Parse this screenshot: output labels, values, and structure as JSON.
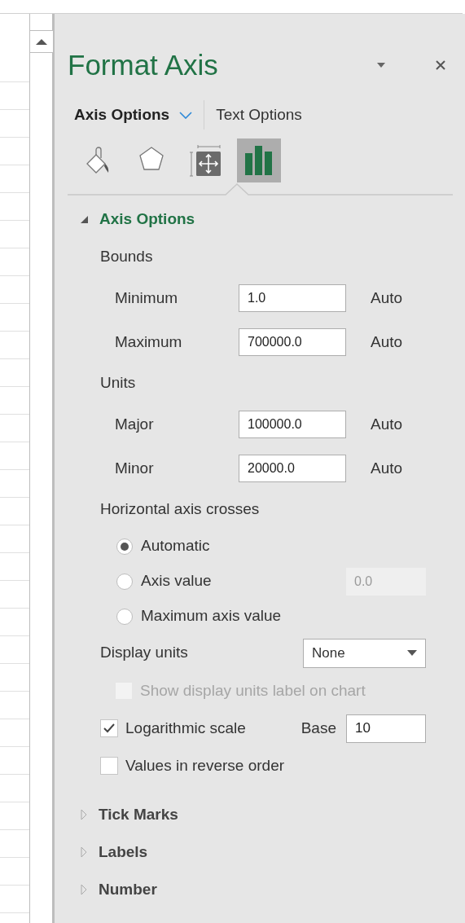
{
  "pane": {
    "title": "Format Axis",
    "tabs": [
      {
        "label": "Axis Options",
        "selected": true
      },
      {
        "label": "Text Options",
        "selected": false
      }
    ],
    "icon_tabs": [
      {
        "kind": "fill",
        "selected": false
      },
      {
        "kind": "effects",
        "selected": false
      },
      {
        "kind": "size",
        "selected": false
      },
      {
        "kind": "axis",
        "selected": true
      }
    ],
    "sections": [
      {
        "title": "Axis Options",
        "expanded": true,
        "rows": [
          {
            "kind": "heading",
            "label": "Bounds"
          },
          {
            "kind": "number",
            "label": "Minimum",
            "value": "1.0",
            "action": "Auto"
          },
          {
            "kind": "number",
            "label": "Maximum",
            "value": "700000.0",
            "action": "Auto"
          },
          {
            "kind": "heading",
            "label": "Units"
          },
          {
            "kind": "number",
            "label": "Major",
            "value": "100000.0",
            "action": "Auto"
          },
          {
            "kind": "number",
            "label": "Minor",
            "value": "20000.0",
            "action": "Auto"
          },
          {
            "kind": "heading",
            "label": "Horizontal axis crosses"
          },
          {
            "kind": "radio",
            "label": "Automatic",
            "selected": true
          },
          {
            "kind": "radio",
            "label": "Axis value",
            "selected": false,
            "field": {
              "value": "0.0",
              "disabled": true
            }
          },
          {
            "kind": "radio",
            "label": "Maximum axis value",
            "selected": false
          },
          {
            "kind": "dropdown",
            "label": "Display units",
            "value": "None"
          },
          {
            "kind": "checkbox",
            "label": "Show display units label on chart",
            "checked": false,
            "disabled": true
          },
          {
            "kind": "checkbox",
            "label": "Logarithmic scale",
            "checked": true,
            "disabled": false,
            "field": {
              "label": "Base",
              "value": "10"
            }
          },
          {
            "kind": "checkbox",
            "label": "Values in reverse order",
            "checked": false,
            "disabled": false
          }
        ]
      },
      {
        "title": "Tick Marks",
        "expanded": false
      },
      {
        "title": "Labels",
        "expanded": false
      },
      {
        "title": "Number",
        "expanded": false
      }
    ]
  }
}
